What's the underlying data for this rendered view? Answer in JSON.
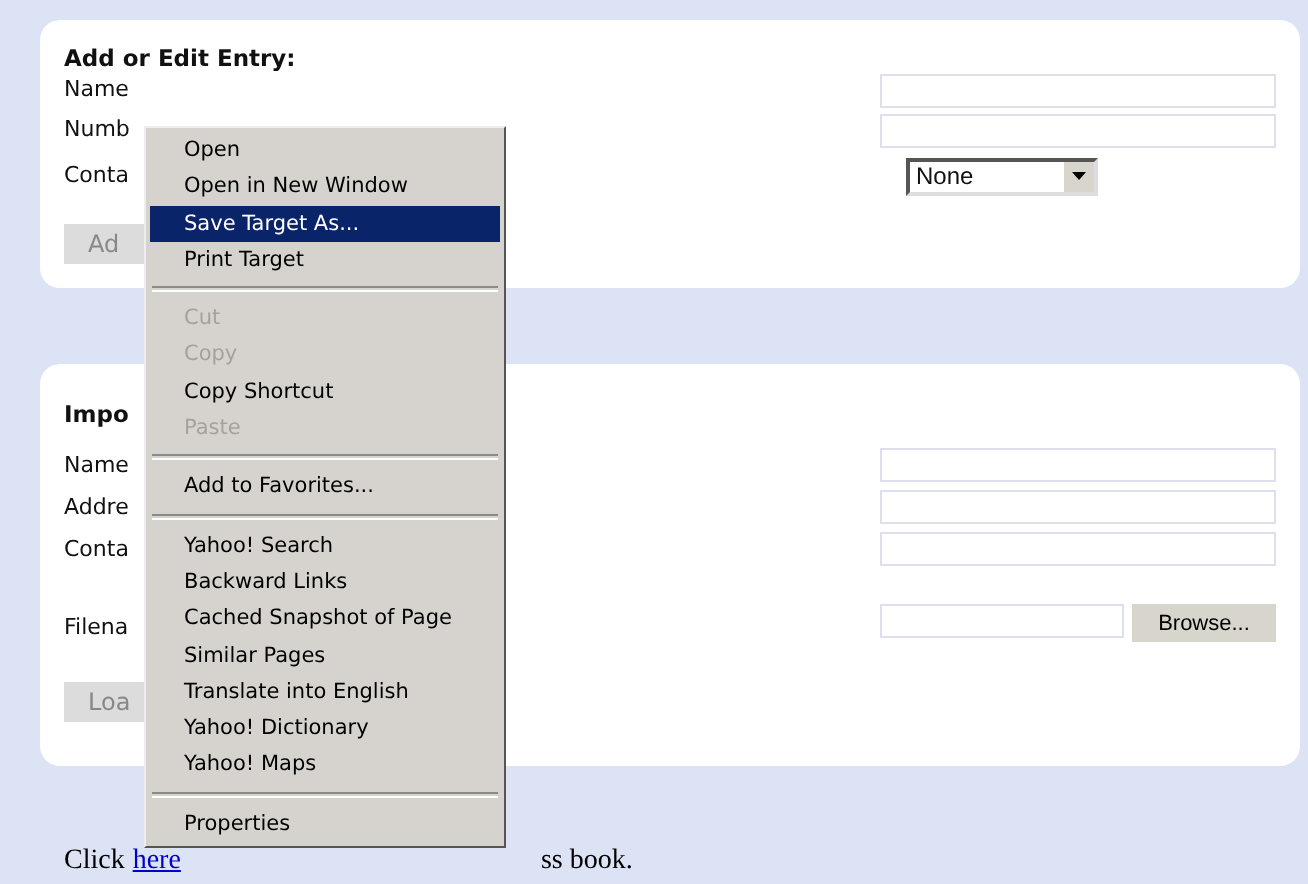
{
  "add_entry": {
    "title": "Add or Edit Entry:",
    "rows": [
      {
        "label": "Name",
        "kind": "text"
      },
      {
        "label": "Numb",
        "kind": "text"
      },
      {
        "label": "Conta",
        "kind": "select",
        "value": "None"
      }
    ],
    "button": "Ad"
  },
  "import": {
    "title": "Impo",
    "rows": [
      {
        "label": "Name",
        "kind": "text"
      },
      {
        "label": "Addre",
        "kind": "text"
      },
      {
        "label": "Conta",
        "kind": "text"
      },
      {
        "label": "Filena",
        "kind": "file",
        "button": "Browse..."
      }
    ],
    "button": "Loa"
  },
  "footer": {
    "lead": "Click",
    "link": "here",
    "tail": "ss book."
  },
  "context_menu": [
    {
      "kind": "item",
      "label": "Open",
      "disabled": false,
      "selected": false
    },
    {
      "kind": "item",
      "label": "Open in New Window",
      "disabled": false,
      "selected": false
    },
    {
      "kind": "item",
      "label": "Save Target As...",
      "disabled": false,
      "selected": true
    },
    {
      "kind": "item",
      "label": "Print Target",
      "disabled": false,
      "selected": false
    },
    {
      "kind": "separator"
    },
    {
      "kind": "item",
      "label": "Cut",
      "disabled": true,
      "selected": false
    },
    {
      "kind": "item",
      "label": "Copy",
      "disabled": true,
      "selected": false
    },
    {
      "kind": "item",
      "label": "Copy Shortcut",
      "disabled": false,
      "selected": false
    },
    {
      "kind": "item",
      "label": "Paste",
      "disabled": true,
      "selected": false
    },
    {
      "kind": "separator"
    },
    {
      "kind": "item",
      "label": "Add to Favorites...",
      "disabled": false,
      "selected": false
    },
    {
      "kind": "separator"
    },
    {
      "kind": "item",
      "label": "Yahoo! Search",
      "disabled": false,
      "selected": false
    },
    {
      "kind": "item",
      "label": "Backward Links",
      "disabled": false,
      "selected": false
    },
    {
      "kind": "item",
      "label": "Cached Snapshot of Page",
      "disabled": false,
      "selected": false
    },
    {
      "kind": "item",
      "label": "Similar Pages",
      "disabled": false,
      "selected": false
    },
    {
      "kind": "item",
      "label": "Translate into English",
      "disabled": false,
      "selected": false
    },
    {
      "kind": "item",
      "label": "Yahoo! Dictionary",
      "disabled": false,
      "selected": false
    },
    {
      "kind": "item",
      "label": "Yahoo! Maps",
      "disabled": false,
      "selected": false
    },
    {
      "kind": "separator"
    },
    {
      "kind": "item",
      "label": "Properties",
      "disabled": false,
      "selected": false
    }
  ]
}
